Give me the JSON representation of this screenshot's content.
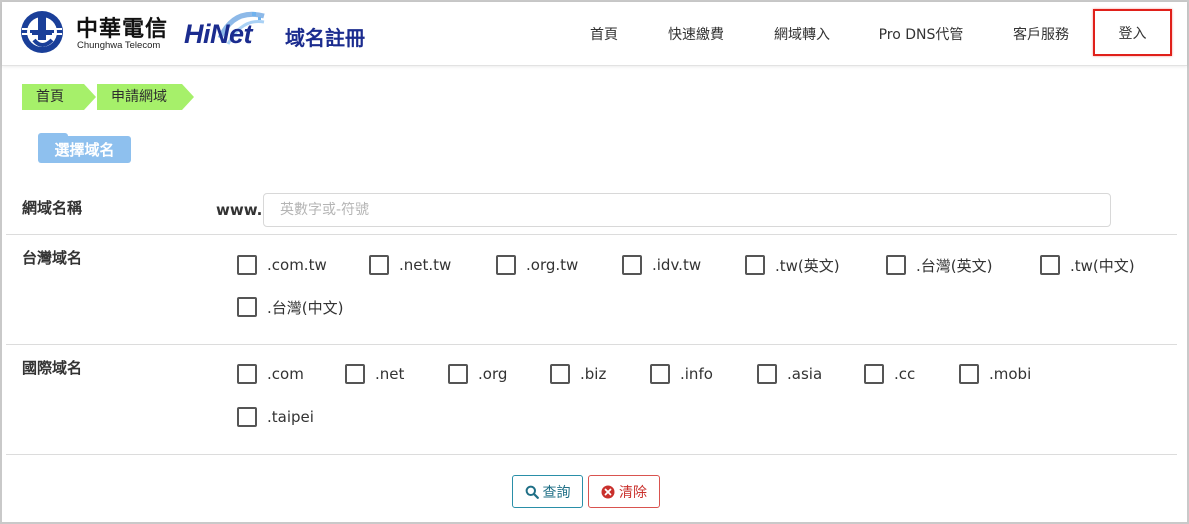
{
  "header": {
    "brand_cn": "中華電信",
    "brand_en": "Chunghwa Telecom",
    "product_logo_word": "HiNet",
    "product_logo_sub": "域名註冊",
    "nav": {
      "home": "首頁",
      "quick_pay": "快速繳費",
      "transfer": "網域轉入",
      "pro_dns": "Pro DNS代管",
      "service": "客戶服務",
      "login": "登入"
    },
    "highlight_color": "#e0201a"
  },
  "breadcrumb": [
    "首頁",
    "申請網域"
  ],
  "section_title": "選擇域名",
  "domain_name": {
    "label": "網域名稱",
    "prefix": "www.",
    "value": "",
    "placeholder": "英數字或-符號"
  },
  "tw_domains": {
    "label": "台灣域名",
    "options": [
      ".com.tw",
      ".net.tw",
      ".org.tw",
      ".idv.tw",
      ".tw(英文)",
      ".台灣(英文)",
      ".tw(中文)",
      ".台灣(中文)"
    ],
    "checked": [
      false,
      false,
      false,
      false,
      false,
      false,
      false,
      false
    ]
  },
  "intl_domains": {
    "label": "國際域名",
    "options": [
      ".com",
      ".net",
      ".org",
      ".biz",
      ".info",
      ".asia",
      ".cc",
      ".mobi",
      ".taipei"
    ],
    "checked": [
      false,
      false,
      false,
      false,
      false,
      false,
      false,
      false,
      false
    ]
  },
  "actions": {
    "query": "查詢",
    "query_icon": "search-icon",
    "clear": "清除",
    "clear_icon": "times-circle-icon"
  },
  "colors": {
    "breadcrumb": "#a6f06a",
    "section_tag": "#8ec0ee",
    "query_button": "#2a8fa8",
    "clear_button": "#d9534f",
    "brand_blue": "#1b2c8f"
  }
}
